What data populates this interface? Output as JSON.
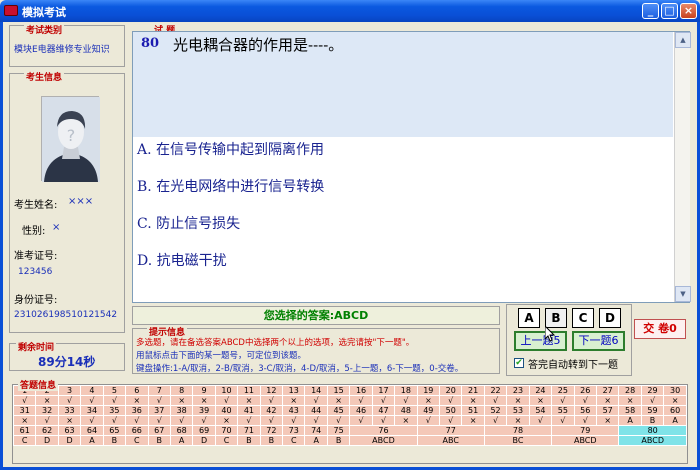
{
  "window": {
    "title": "模拟考试",
    "min": "_",
    "max": "□",
    "close": "×"
  },
  "category": {
    "legend": "考试类别",
    "value": "模块E电器维修专业知识"
  },
  "examinee": {
    "legend": "考生信息",
    "name_label": "考生姓名:",
    "name_value": "×××",
    "gender_label": "性别:",
    "gender_value": "×",
    "ticket_label": "准考证号:",
    "ticket_value": "123456",
    "id_label": "身份证号:",
    "id_value": "231026198510121542"
  },
  "time": {
    "legend": "剩余时间",
    "value": "89分14秒"
  },
  "question": {
    "legend": "试 题",
    "number": "80",
    "text": "光电耦合器的作用是----。",
    "options": [
      "A. 在信号传输中起到隔离作用",
      "B. 在光电网络中进行信号转换",
      "C. 防止信号损失",
      "D. 抗电磁干扰"
    ]
  },
  "answer": {
    "text": "您选择的答案:ABCD"
  },
  "hint": {
    "legend": "提示信息",
    "line1": "多选题，请在备选答案ABCD中选择两个以上的选项，选完请按\"下一题\"。",
    "line2": "用鼠标点击下面的某一题号，可定位到该题。",
    "line3": "键盘操作:1-A/取消，2-B/取消，3-C/取消，4-D/取消，5-上一题，6-下一题，0-交卷。"
  },
  "controls": {
    "a": "A",
    "b": "B",
    "c": "C",
    "d": "D",
    "prev": "上一题5",
    "next": "下一题6",
    "submit": "交 卷0",
    "auto_next": "答完自动转到下一题"
  },
  "grid": {
    "legend": "答题信息",
    "row1_nums": [
      "1",
      "2",
      "3",
      "4",
      "5",
      "6",
      "7",
      "8",
      "9",
      "10",
      "11",
      "12",
      "13",
      "14",
      "15",
      "16",
      "17",
      "18",
      "19",
      "20",
      "21",
      "22",
      "23",
      "24",
      "25",
      "26",
      "27",
      "28",
      "29",
      "30"
    ],
    "row1_ans": [
      "√",
      "×",
      "√",
      "√",
      "√",
      "×",
      "√",
      "×",
      "×",
      "√",
      "×",
      "√",
      "×",
      "√",
      "×",
      "√",
      "√",
      "√",
      "×",
      "√",
      "×",
      "√",
      "×",
      "×",
      "√",
      "√",
      "×",
      "×",
      "√",
      "×"
    ],
    "row2_nums": [
      "31",
      "32",
      "33",
      "34",
      "35",
      "36",
      "37",
      "38",
      "39",
      "40",
      "41",
      "42",
      "43",
      "44",
      "45",
      "46",
      "47",
      "48",
      "49",
      "50",
      "51",
      "52",
      "53",
      "54",
      "55",
      "56",
      "57",
      "58",
      "59",
      "60"
    ],
    "row2_ans": [
      "×",
      "√",
      "×",
      "√",
      "√",
      "√",
      "√",
      "√",
      "√",
      "×",
      "√",
      "√",
      "√",
      "√",
      "√",
      "√",
      "√",
      "×",
      "√",
      "√",
      "×",
      "√",
      "×",
      "√",
      "√",
      "√",
      "×",
      "A",
      "B",
      "A"
    ],
    "row3_nums": [
      "61",
      "62",
      "63",
      "64",
      "65",
      "66",
      "67",
      "68",
      "69",
      "70",
      "71",
      "72",
      "73",
      "74",
      "75"
    ],
    "row3_ans": [
      "C",
      "D",
      "D",
      "A",
      "B",
      "C",
      "B",
      "A",
      "D",
      "C",
      "B",
      "B",
      "C",
      "A",
      "B"
    ],
    "row3_multi_nums": [
      "76",
      "77",
      "78",
      "79",
      "80"
    ],
    "row3_multi_ans": [
      "ABCD",
      "ABC",
      "BC",
      "ABCD",
      "ABCD"
    ]
  }
}
